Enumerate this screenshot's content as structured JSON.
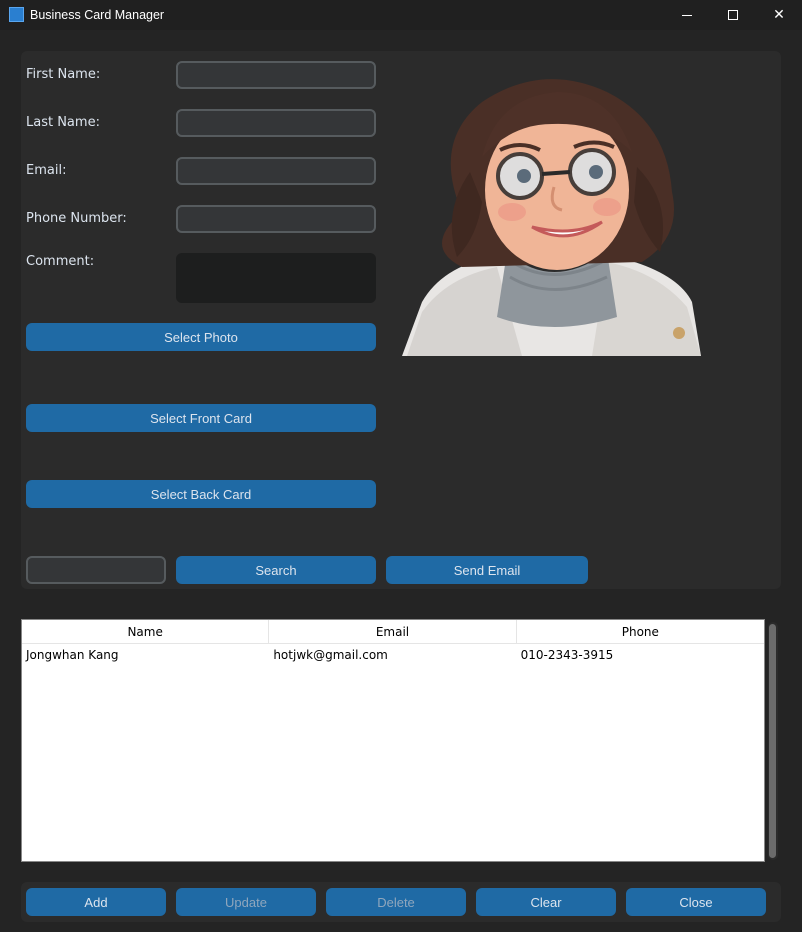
{
  "window": {
    "title": "Business Card Manager",
    "minimize_label": "",
    "maximize_label": "",
    "close_label": "✕"
  },
  "form": {
    "first_name_label": "First Name:",
    "last_name_label": "Last Name:",
    "email_label": "Email:",
    "phone_label": "Phone Number:",
    "comment_label": "Comment:",
    "first_name_value": "",
    "last_name_value": "",
    "email_value": "",
    "phone_value": "",
    "comment_value": ""
  },
  "buttons": {
    "select_photo": "Select Photo",
    "select_front_card": "Select Front Card",
    "select_back_card": "Select Back Card",
    "search": "Search",
    "send_email": "Send Email"
  },
  "search": {
    "value": ""
  },
  "table": {
    "columns": [
      "Name",
      "Email",
      "Phone"
    ],
    "rows": [
      [
        "Jongwhan Kang",
        "hotjwk@gmail.com",
        "010-2343-3915"
      ]
    ]
  },
  "actions": {
    "add": "Add",
    "update": "Update",
    "delete": "Delete",
    "clear": "Clear",
    "close": "Close"
  },
  "colors": {
    "accent": "#1f6aa5",
    "window_bg": "#242424",
    "frame_bg": "#2b2b2b",
    "entry_bg": "#343638"
  },
  "icons": {
    "app": "app-icon",
    "minimize": "minimize-icon",
    "maximize": "maximize-icon",
    "close": "close-icon"
  }
}
